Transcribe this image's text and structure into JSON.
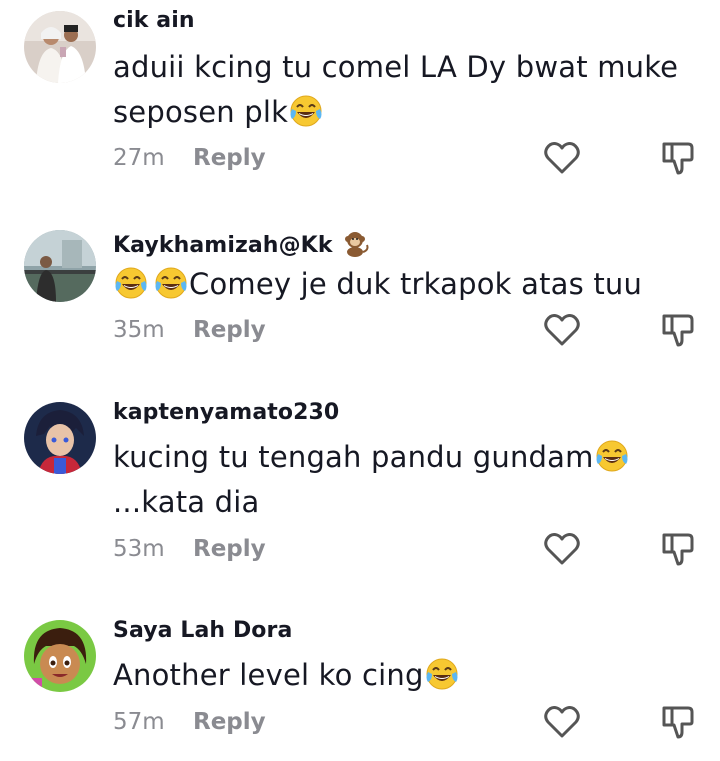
{
  "comments": [
    {
      "username": "cik ain",
      "text_parts": [
        "aduii kcing tu comel LA Dy bwat muke seposen plk"
      ],
      "time": "27m",
      "reply": "Reply",
      "avatar_icon": "wedding-couple-avatar"
    },
    {
      "username": "Kaykhamizah@Kk",
      "text_parts": [
        "Comey je duk trkapok atas tuu"
      ],
      "time": "35m",
      "reply": "Reply",
      "avatar_icon": "person-on-balcony-avatar"
    },
    {
      "username": "kaptenyamato230",
      "text_parts": [
        "kucing tu tengah pandu gundam",
        "...kata dia"
      ],
      "time": "53m",
      "reply": "Reply",
      "avatar_icon": "anime-character-avatar"
    },
    {
      "username": "Saya Lah Dora",
      "text_parts": [
        "Another level ko cing"
      ],
      "time": "57m",
      "reply": "Reply",
      "avatar_icon": "dora-avatar"
    }
  ],
  "icons": {
    "like": "heart-outline-icon",
    "dislike": "thumbs-down-outline-icon",
    "laugh_emoji": "face-with-tears-of-joy-emoji",
    "monkey_emoji": "monkey-emoji"
  },
  "colors": {
    "text": "#161823",
    "meta": "#8a8b91",
    "icon": "#555555"
  }
}
